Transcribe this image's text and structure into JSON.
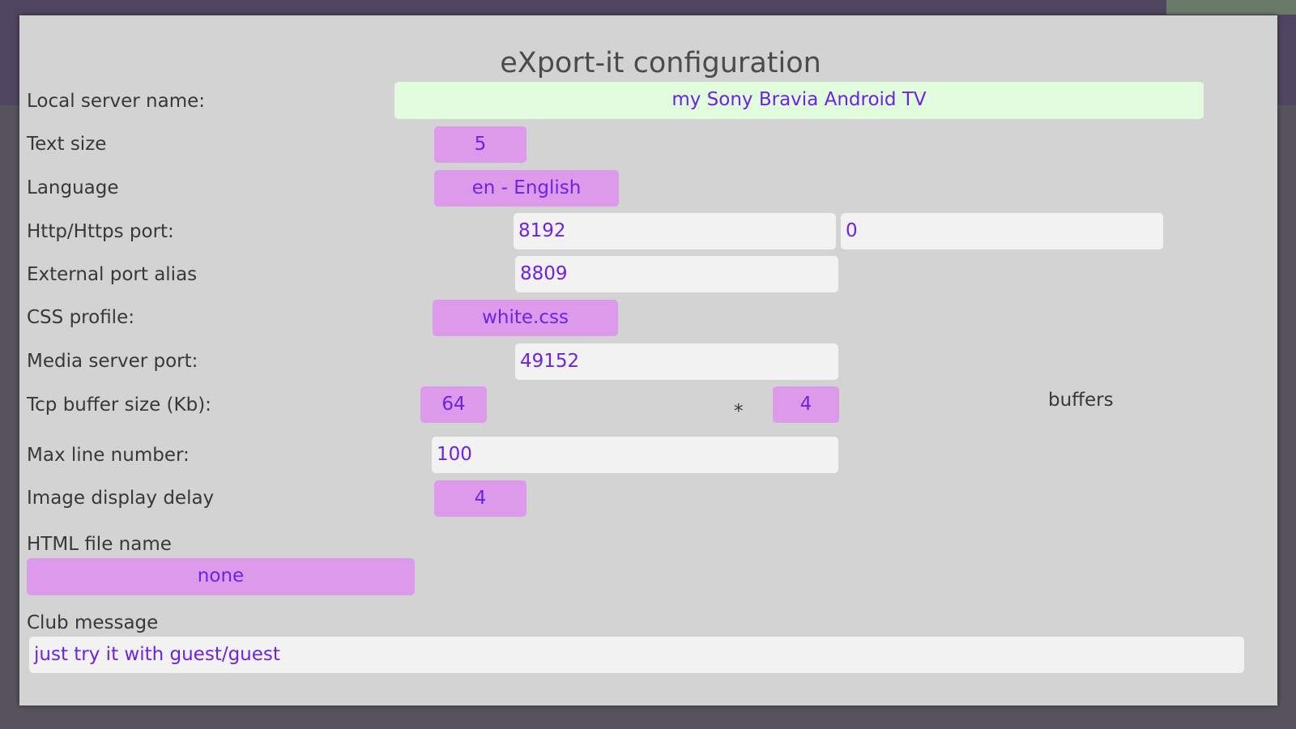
{
  "dialog": {
    "title": "eXport-it configuration"
  },
  "local_server": {
    "label": "Local server name:",
    "value": "my Sony Bravia Android TV"
  },
  "text_size": {
    "label": "Text size",
    "value": "5"
  },
  "language": {
    "label": "Language",
    "value": "en - English"
  },
  "http_port": {
    "label": "Http/Https port:",
    "http_value": "8192",
    "https_value": "0"
  },
  "external_port": {
    "label": "External port alias",
    "value": "8809"
  },
  "css_profile": {
    "label": "CSS profile:",
    "value": "white.css"
  },
  "media_port": {
    "label": "Media server port:",
    "value": "49152"
  },
  "tcp_buffer": {
    "label": "Tcp buffer size (Kb):",
    "size_value": "64",
    "multiply_symbol": "*",
    "count_value": "4",
    "unit_label": "buffers"
  },
  "max_line": {
    "label": "Max line number:",
    "value": "100"
  },
  "image_delay": {
    "label": "Image display delay",
    "value": "4"
  },
  "html_file": {
    "label": "HTML file name",
    "value": "none"
  },
  "club_message": {
    "label": "Club message",
    "value": "just try it with guest/guest"
  },
  "colors": {
    "value_text": "#6d23e6",
    "label_text": "#383838",
    "white_field": "#f2f2f2",
    "green_field": "#e1fbdd",
    "pink_selector": "#dd9aeb",
    "dialog_bg": "#d3d3d3"
  }
}
